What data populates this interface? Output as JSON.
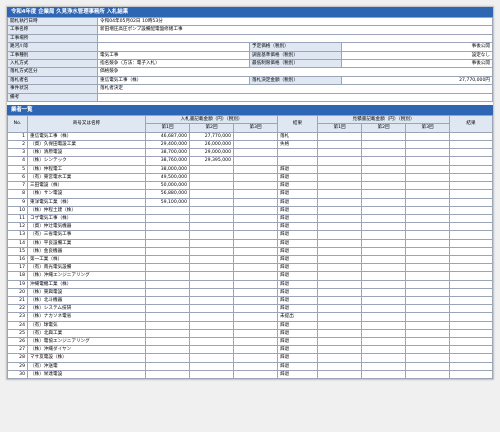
{
  "title": "令和4年度 企業局 久見浄水管理事務所 入札結果",
  "info": {
    "r1": {
      "l": "開札執行日時",
      "v": "令和04年05月02日 10時53分"
    },
    "r2": {
      "l": "工事名称",
      "v": "新田増圧高圧ポンプ設備配電盤修繕工事"
    },
    "r3": {
      "l": "工事場所",
      "v": ""
    },
    "r4": {
      "l": "路河川等",
      "v": "",
      "l2": "予定価格（税別）",
      "v2": "事後公開"
    },
    "r5": {
      "l": "工事種別",
      "v": "電気工事",
      "l2": "調査基準価格（税別）",
      "v2": "設定なし"
    },
    "r6": {
      "l": "入札方式",
      "v": "指名競争（方法：電子入札）",
      "l2": "最低制限価格（税別）",
      "v2": "事後公開"
    },
    "r7": {
      "l": "落札方式区分",
      "v": "価格競争"
    },
    "r8": {
      "l": "落札者名",
      "v": "重信電気工事（株）",
      "l2": "落札決定金額（税別）",
      "v2": "27,770,000円"
    },
    "r9": {
      "l": "事件状況",
      "v": "落札者決定"
    },
    "r10": {
      "l": "備考",
      "v": ""
    }
  },
  "list": {
    "header": "業者一覧",
    "cols": {
      "no": "No.",
      "name": "商号又は名称",
      "bid": "入札書記載金額（円）（税別）",
      "r1": "第1回",
      "r2": "第2回",
      "r3": "第3回",
      "result": "結果",
      "est": "見積書記載金額（円）（税別）",
      "result2": "結果"
    },
    "rows": [
      {
        "no": "1",
        "name": "重信電気工事（株）",
        "b1": "46,687,000",
        "b2": "27,770,000",
        "b3": "",
        "res": "落札"
      },
      {
        "no": "2",
        "name": "（資）久保田電設工業",
        "b1": "29,400,000",
        "b2": "26,000,000",
        "b3": "",
        "res": "失格"
      },
      {
        "no": "3",
        "name": "（株）清原電設",
        "b1": "38,700,000",
        "b2": "29,000,000",
        "b3": "",
        "res": ""
      },
      {
        "no": "4",
        "name": "（株）シンテック",
        "b1": "38,760,000",
        "b2": "29,395,000",
        "b3": "",
        "res": ""
      },
      {
        "no": "5",
        "name": "（株）仲程電工",
        "b1": "38,000,000",
        "b2": "",
        "b3": "",
        "res": "辞退"
      },
      {
        "no": "6",
        "name": "（有）東宮電水工業",
        "b1": "49,500,000",
        "b2": "",
        "b3": "",
        "res": "辞退"
      },
      {
        "no": "7",
        "name": "三田電設（株）",
        "b1": "50,000,000",
        "b2": "",
        "b3": "",
        "res": "辞退"
      },
      {
        "no": "8",
        "name": "（株）サン電設",
        "b1": "56,880,000",
        "b2": "",
        "b3": "",
        "res": "辞退"
      },
      {
        "no": "9",
        "name": "東洋電気工業（株）",
        "b1": "59,100,000",
        "b2": "",
        "b3": "",
        "res": "辞退"
      },
      {
        "no": "10",
        "name": "（株）仲程土建（株）",
        "b1": "",
        "b2": "",
        "b3": "",
        "res": "辞退"
      },
      {
        "no": "11",
        "name": "コザ電気工事（株）",
        "b1": "",
        "b2": "",
        "b3": "",
        "res": "辞退"
      },
      {
        "no": "12",
        "name": "（資）仲辻電気機器",
        "b1": "",
        "b2": "",
        "b3": "",
        "res": "辞退"
      },
      {
        "no": "13",
        "name": "（有）三省電気工事",
        "b1": "",
        "b2": "",
        "b3": "",
        "res": "辞退"
      },
      {
        "no": "14",
        "name": "（株）平良設備工業",
        "b1": "",
        "b2": "",
        "b3": "",
        "res": "辞退"
      },
      {
        "no": "15",
        "name": "（株）金良機器",
        "b1": "",
        "b2": "",
        "b3": "",
        "res": "辞退"
      },
      {
        "no": "16",
        "name": "第一工業（株）",
        "b1": "",
        "b2": "",
        "b3": "",
        "res": "辞退"
      },
      {
        "no": "17",
        "name": "（有）南光電気設備",
        "b1": "",
        "b2": "",
        "b3": "",
        "res": "辞退"
      },
      {
        "no": "18",
        "name": "（株）沖縄エンジニアリング",
        "b1": "",
        "b2": "",
        "b3": "",
        "res": "辞退"
      },
      {
        "no": "19",
        "name": "沖縄電機工業（株）",
        "b1": "",
        "b2": "",
        "b3": "",
        "res": "辞退"
      },
      {
        "no": "20",
        "name": "（株）東興電設",
        "b1": "",
        "b2": "",
        "b3": "",
        "res": "辞退"
      },
      {
        "no": "21",
        "name": "（株）北斗機器",
        "b1": "",
        "b2": "",
        "b3": "",
        "res": "辞退"
      },
      {
        "no": "22",
        "name": "（株）システム技研",
        "b1": "",
        "b2": "",
        "b3": "",
        "res": "辞退"
      },
      {
        "no": "23",
        "name": "（株）ナカソネ電省",
        "b1": "",
        "b2": "",
        "b3": "",
        "res": "未提出"
      },
      {
        "no": "24",
        "name": "（有）球電気",
        "b1": "",
        "b2": "",
        "b3": "",
        "res": "辞退"
      },
      {
        "no": "25",
        "name": "（有）北興工業",
        "b1": "",
        "b2": "",
        "b3": "",
        "res": "辞退"
      },
      {
        "no": "26",
        "name": "（株）電協エンジニアリング",
        "b1": "",
        "b2": "",
        "b3": "",
        "res": "辞退"
      },
      {
        "no": "27",
        "name": "（株）沖縄ダイヤン",
        "b1": "",
        "b2": "",
        "b3": "",
        "res": "辞退"
      },
      {
        "no": "28",
        "name": "マサ友電設（株）",
        "b1": "",
        "b2": "",
        "b3": "",
        "res": "辞退"
      },
      {
        "no": "29",
        "name": "（有）沖送電",
        "b1": "",
        "b2": "",
        "b3": "",
        "res": "辞退"
      },
      {
        "no": "30",
        "name": "（株）栄達電設",
        "b1": "",
        "b2": "",
        "b3": "",
        "res": "辞退"
      }
    ]
  }
}
